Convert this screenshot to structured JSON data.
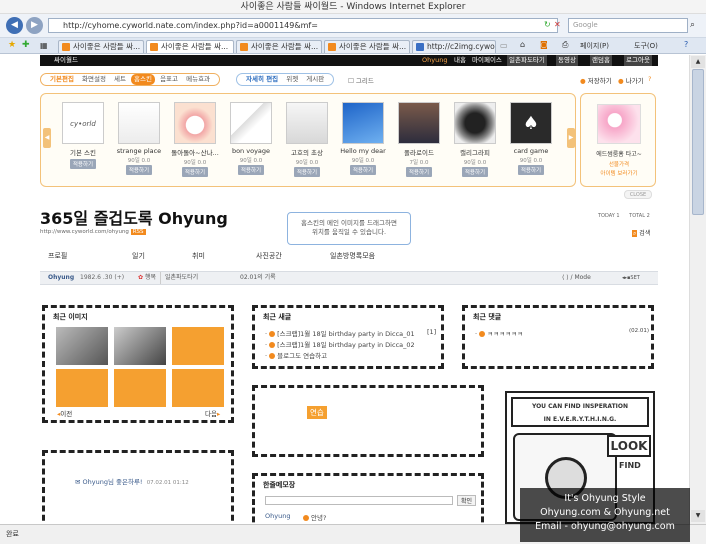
{
  "window": {
    "title": "사이좋은 사람들 싸이월드 - Windows Internet Explorer"
  },
  "address": {
    "url": "http://cyhome.cyworld.nate.com/index.php?id=a0001149&mf=",
    "search_placeholder": "Google"
  },
  "tabs": [
    "사이좋은 사람들 싸...",
    "사이좋은 사람들 싸...",
    "사이좋은 사람들 싸...",
    "사이좋은 사람들 싸...",
    "http://c2img.cyworld..."
  ],
  "ie_toolbar": {
    "page": "페이지(P)",
    "tools": "도구(O)"
  },
  "topbar": {
    "logo": "싸이월드",
    "user": "Ohyung",
    "links": [
      "내홈",
      "마이페이스",
      "일촌파도타기",
      "동영상",
      "랜덤홈",
      "로그아웃"
    ]
  },
  "menu": {
    "edit_tabs": [
      "기본편집",
      "화면설정",
      "세트",
      "홈스킨",
      "음표고",
      "메뉴효과"
    ],
    "edit_tabs_active": 3,
    "detail_tabs": [
      "자세히 편집",
      "위젯",
      "게시판"
    ],
    "grid_label": "그리드",
    "save": "저장하기",
    "exit": "나가기"
  },
  "skins": [
    {
      "name": "기본 스킨",
      "info": "",
      "button": "적용하기"
    },
    {
      "name": "strange place",
      "info": "90일 0.0",
      "button": "적용하기"
    },
    {
      "name": "돌아돌아~산나...",
      "info": "90일 0.0",
      "button": "적용하기"
    },
    {
      "name": "bon voyage",
      "info": "90일 0.0",
      "button": "적용하기"
    },
    {
      "name": "고호의 초상",
      "info": "90일 0.0",
      "button": "적용하기"
    },
    {
      "name": "Hello my dear",
      "info": "90일 0.0",
      "button": "적용하기"
    },
    {
      "name": "폴라로이드",
      "info": "7일 0.0",
      "button": "적용하기"
    },
    {
      "name": "캘리그라피",
      "info": "90일 0.0",
      "button": "적용하기"
    },
    {
      "name": "card game",
      "info": "90일 0.0",
      "button": "적용하기"
    }
  ],
  "side_skin": {
    "name": "에드썸룸홈 타고~",
    "line1": "선물가격",
    "line2": "아이템 보러가기"
  },
  "close_label": "CLOSE",
  "home": {
    "title": "365일 즐겁도록 Ohyung",
    "url": "http://www.cyworld.com/ohyung",
    "rss": "RSS",
    "today": "TODAY 1",
    "total": "TOTAL 2",
    "search": "검색",
    "drag_tip_1": "홈스킨의 메인 이미지를 드래그하면",
    "drag_tip_2": "위치를 움직일 수 있습니다."
  },
  "nav": [
    "프로필",
    "일기",
    "취미",
    "사진공간",
    "일촌방명록모음"
  ],
  "status": {
    "name": "Ohyung",
    "birth": "1982.6 .30 (+)",
    "mood_label": "행복",
    "fadoki": "일촌파도타기",
    "today_record": "02.01의 기록",
    "mode": "Mode"
  },
  "recent_images": {
    "title": "최근 이미지",
    "prev": "이전",
    "next": "다음"
  },
  "recent_posts": {
    "title": "최근 새글",
    "items": [
      {
        "text": "[스크랩]1월 18일 birthday party in Dicca_01",
        "count": "[1]"
      },
      {
        "text": "[스크랩]1월 18일 birthday party in Dicca_02",
        "count": ""
      },
      {
        "text": "블로그도 연습하고",
        "count": ""
      }
    ]
  },
  "recent_comments": {
    "title": "최근 댓글",
    "items": [
      {
        "text": "ㅋㅋㅋㅋㅋㅋ",
        "date": "(02.01)"
      }
    ]
  },
  "practice": {
    "label": "연습"
  },
  "guest": {
    "text": "Ohyung님 좋은하루!",
    "date": "07.02.01 01:12"
  },
  "memo": {
    "title": "한줄메모장",
    "button": "확인",
    "name": "Ohyung",
    "text": "안녕?"
  },
  "inspiration": {
    "line1": "YOU CAN FIND INSPERATION",
    "line2": "IN E.V.E.R.Y.T.H.I.N.G.",
    "look": "LOOK",
    "find": "FIND"
  },
  "statusbar": {
    "text": "완료"
  },
  "watermark": {
    "line1": "It's Ohyung Style",
    "line2": "Ohyung.com & Ohyung.net",
    "line3": "Email - ohyung@ohyung.com"
  }
}
